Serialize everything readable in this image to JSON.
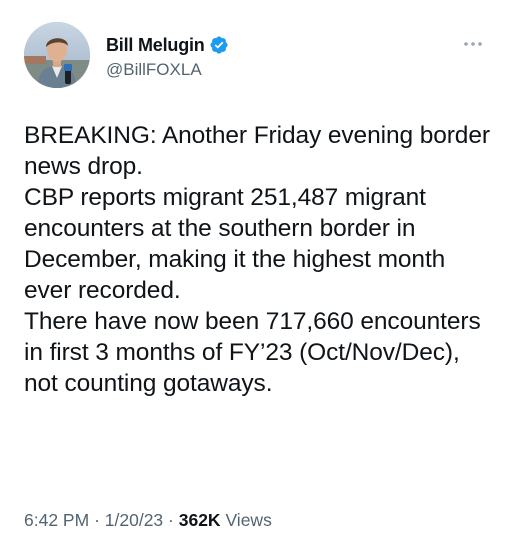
{
  "author": {
    "display_name": "Bill Melugin",
    "handle": "@BillFOXLA",
    "verified": true,
    "avatar_icon": "profile-photo"
  },
  "menu": {
    "icon": "more-horizontal-icon"
  },
  "tweet": {
    "paragraphs": [
      "BREAKING: Another Friday evening border news drop.",
      "CBP reports migrant 251,487 migrant encounters at the southern border in December, making it the highest month ever recorded.",
      "There have now been 717,660 encounters in first 3 months of FY’23 (Oct/Nov/Dec), not counting gotaways."
    ]
  },
  "meta": {
    "time": "6:42 PM",
    "separator1": "·",
    "date": "1/20/23",
    "separator2": "·",
    "views_count": "362K",
    "views_label": "Views"
  },
  "colors": {
    "text_primary": "#0f1419",
    "text_secondary": "#536471",
    "verified_blue": "#1d9bf0"
  }
}
